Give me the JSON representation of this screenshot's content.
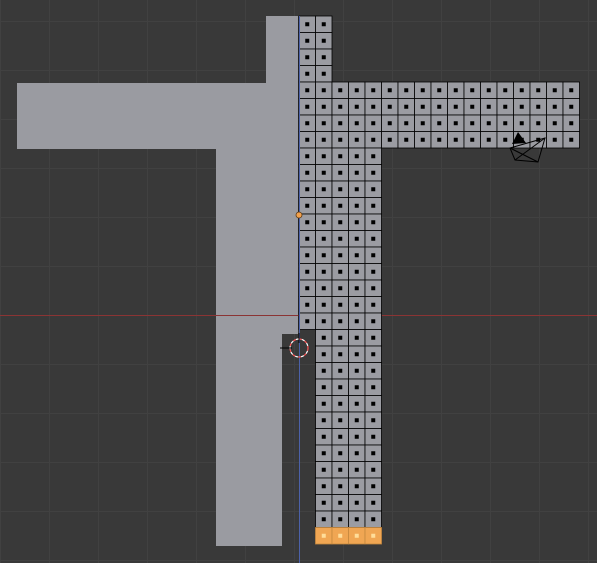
{
  "viewport": {
    "background": "#393939",
    "grid_color": "#414141",
    "x_axis_color": "#8b3434",
    "y_axis_color": "#4c61a8",
    "shape_color": "#9a9ba1",
    "selected_color": "#f0a653"
  },
  "objects": {
    "solid_shape": "mesh-object",
    "grid_mesh": "edit-mesh",
    "camera": "camera-object",
    "cursor": "3d-cursor",
    "origin": "object-origin"
  }
}
